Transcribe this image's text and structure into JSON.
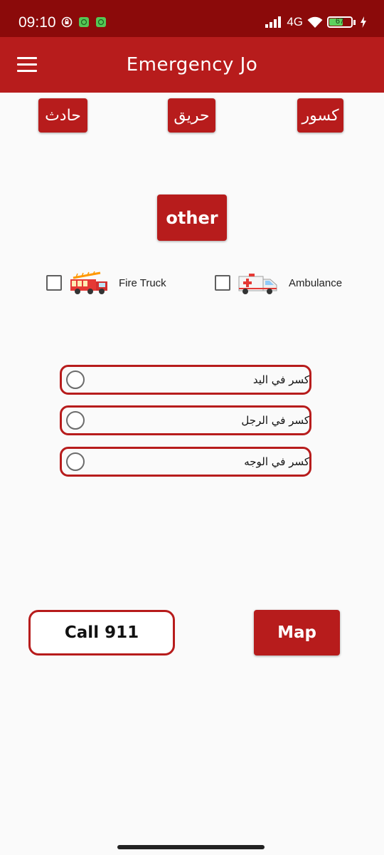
{
  "status_bar": {
    "time": "09:10",
    "network": "4G",
    "battery_level": "67"
  },
  "app_bar": {
    "title": "Emergency Jo"
  },
  "categories": {
    "accident": "حادث",
    "fire": "حريق",
    "fractures": "كسور",
    "other": "other"
  },
  "vehicles": {
    "fire_truck": "Fire Truck",
    "ambulance": "Ambulance"
  },
  "options": [
    {
      "label": "كسر في اليد"
    },
    {
      "label": "كسر في الرجل"
    },
    {
      "label": "كسر في الوجه"
    }
  ],
  "actions": {
    "call": "Call 911",
    "map": "Map"
  },
  "colors": {
    "primary": "#b71c1c",
    "status_bar": "#8b0a0a",
    "battery": "#5dd05d"
  }
}
